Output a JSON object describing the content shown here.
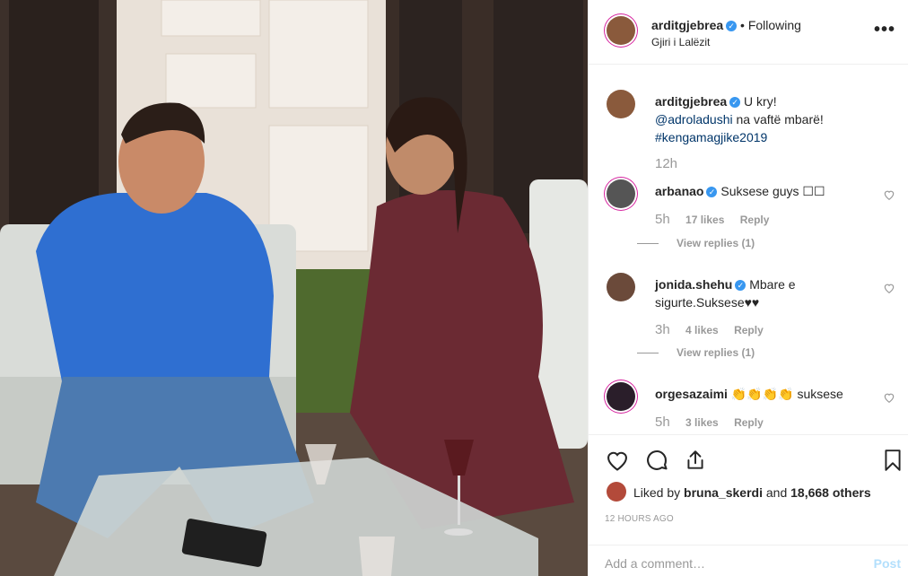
{
  "post": {
    "username": "arditgjebrea",
    "separator": "•",
    "follow_label": "Following",
    "location": "Gjiri i Lalëzit",
    "more_label": "•••"
  },
  "caption": {
    "username": "arditgjebrea",
    "text_1": "U kry!",
    "mention": "@adroladushi",
    "text_2": "na vaftë mbarë!",
    "hashtag": "#kengamagjike2019",
    "time": "12h"
  },
  "comments": [
    {
      "username": "arbanao",
      "text": "Suksese guys ☐☐",
      "time": "5h",
      "likes": "17 likes",
      "reply": "Reply",
      "view_replies": "View replies (1)"
    },
    {
      "username": "jonida.shehu",
      "text": "Mbare e sigurte.Suksese♥♥",
      "time": "3h",
      "likes": "4 likes",
      "reply": "Reply",
      "view_replies": "View replies (1)"
    },
    {
      "username": "orgesazaimi",
      "text": "👏👏👏👏 suksese",
      "time": "5h",
      "likes": "3 likes",
      "reply": "Reply"
    }
  ],
  "likes": {
    "prefix": "Liked by",
    "user": "bruna_skerdi",
    "middle": "and",
    "count": "18,668 others"
  },
  "timestamp": "12 HOURS AGO",
  "add_comment": {
    "placeholder": "Add a comment…",
    "post_label": "Post"
  },
  "colors": {
    "verified": "#3897f0",
    "link": "#003569",
    "muted": "#999999",
    "post_disabled": "#b2dffc"
  }
}
